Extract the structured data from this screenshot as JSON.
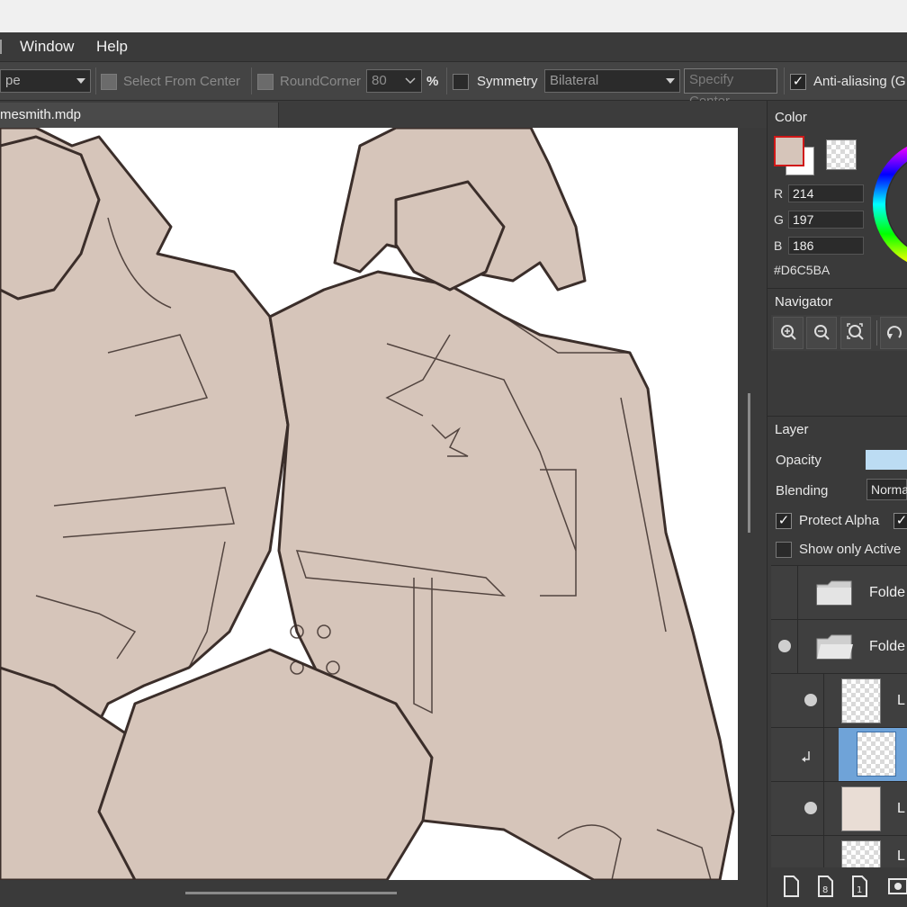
{
  "menu": {
    "items": [
      "Window",
      "Help"
    ]
  },
  "toolbar": {
    "shape_combo_text": "pe",
    "select_from_center": "Select From Center",
    "round_corner": "RoundCorner",
    "round_corner_value": "80",
    "percent": "%",
    "symmetry": "Symmetry",
    "symmetry_value": "Bilateral",
    "specify_center": "Specify Center",
    "anti_aliasing": "Anti-aliasing (G",
    "check_mark": "✓"
  },
  "document": {
    "tab_title": "mesmith.mdp"
  },
  "color_panel": {
    "title": "Color",
    "r_label": "R",
    "r_value": "214",
    "g_label": "G",
    "g_value": "197",
    "b_label": "B",
    "b_value": "186",
    "hex": "#D6C5BA",
    "foreground_color": "#D6C5BA",
    "background_color": "#FFFFFF"
  },
  "navigator_panel": {
    "title": "Navigator"
  },
  "layer_panel": {
    "title": "Layer",
    "opacity_label": "Opacity",
    "blending_label": "Blending",
    "blending_value": "Norma",
    "protect_alpha": "Protect Alpha",
    "show_only_active": "Show only Active",
    "folders": [
      "Folde",
      "Folde"
    ],
    "layers": [
      "L",
      "L",
      "L"
    ]
  },
  "icons": [
    "zoom-in-icon",
    "zoom-out-icon",
    "zoom-fit-icon",
    "rotate-icon",
    "new-layer-icon",
    "new-8bit-layer-icon",
    "new-1bit-layer-icon",
    "layer-mask-icon",
    "folder-icon",
    "clipping-arrow-icon"
  ]
}
